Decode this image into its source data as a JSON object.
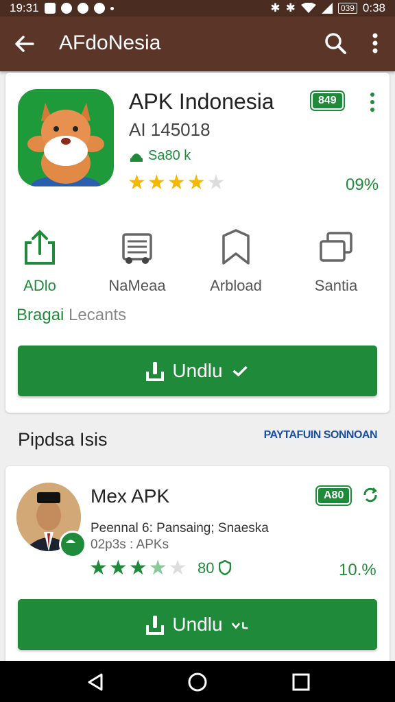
{
  "status_bar": {
    "time_left": "19:31",
    "battery": "039",
    "time_right": "0:38"
  },
  "appbar": {
    "title": "AFdoNesia"
  },
  "app": {
    "title": "APK Indonesia",
    "subtitle": "AI 145018",
    "developer": "Sa80 k",
    "badge": "849",
    "rating_stars": 4,
    "percent": "09%"
  },
  "actions": [
    {
      "label": "ADlo",
      "icon": "share-icon"
    },
    {
      "label": "NaMeaa",
      "icon": "news-icon"
    },
    {
      "label": "Arbload",
      "icon": "bookmark-icon"
    },
    {
      "label": "Santia",
      "icon": "copy-icon"
    }
  ],
  "bagi": {
    "part_a": "Bragai",
    "part_b": " Lecants"
  },
  "download_label": "Undlu",
  "section": {
    "title": "Pipdsa Isis",
    "link": "PAYTAFUIN SONNOAN"
  },
  "app2": {
    "title": "Mex APK",
    "badge": "A80",
    "description": "Peennal 6: Pansaing; Snaeska",
    "meta": "02p3s : APKs",
    "rating_count": "80",
    "percent": "10.%"
  },
  "colors": {
    "primary_green": "#1f8b3a",
    "appbar_brown": "#5b3628",
    "star_yellow": "#f5b800"
  }
}
